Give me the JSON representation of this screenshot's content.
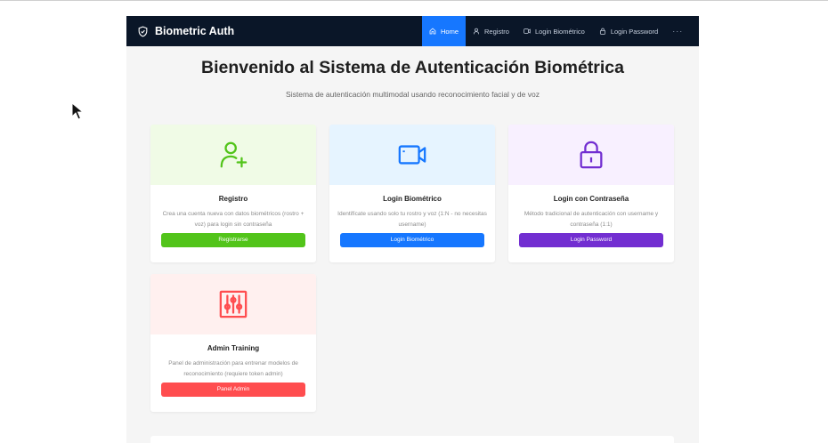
{
  "navbar": {
    "brand": "Biometric Auth",
    "items": [
      {
        "label": "Home",
        "icon": "home-icon",
        "active": true
      },
      {
        "label": "Registro",
        "icon": "user-icon",
        "active": false
      },
      {
        "label": "Login Biométrico",
        "icon": "video-icon",
        "active": false
      },
      {
        "label": "Login Password",
        "icon": "lock-icon",
        "active": false
      }
    ],
    "more": "···"
  },
  "hero": {
    "title": "Bienvenido al Sistema de Autenticación Biométrica",
    "subtitle": "Sistema de autenticación multimodal usando reconocimiento facial y de voz"
  },
  "cards": [
    {
      "title": "Registro",
      "description": "Crea una cuenta nueva con datos biométricos (rostro + voz) para login sin contraseña",
      "button": "Registrarse",
      "icon": "user-add-icon",
      "accent": "#52c41a",
      "bg": "#f0fbe6"
    },
    {
      "title": "Login Biométrico",
      "description": "Identifícate usando solo tu rostro y voz (1:N - no necesitas username)",
      "button": "Login Biométrico",
      "icon": "video-camera-icon",
      "accent": "#1677ff",
      "bg": "#e6f4ff"
    },
    {
      "title": "Login con Contraseña",
      "description": "Método tradicional de autenticación con username y contraseña (1:1)",
      "button": "Login Password",
      "icon": "lock-icon",
      "accent": "#722ed1",
      "bg": "#f8f0ff"
    },
    {
      "title": "Admin Training",
      "description": "Panel de administración para entrenar modelos de reconocimiento (requiere token admin)",
      "button": "Panel Admin",
      "icon": "sliders-icon",
      "accent": "#ff4d4f",
      "bg": "#fff0ef"
    }
  ]
}
